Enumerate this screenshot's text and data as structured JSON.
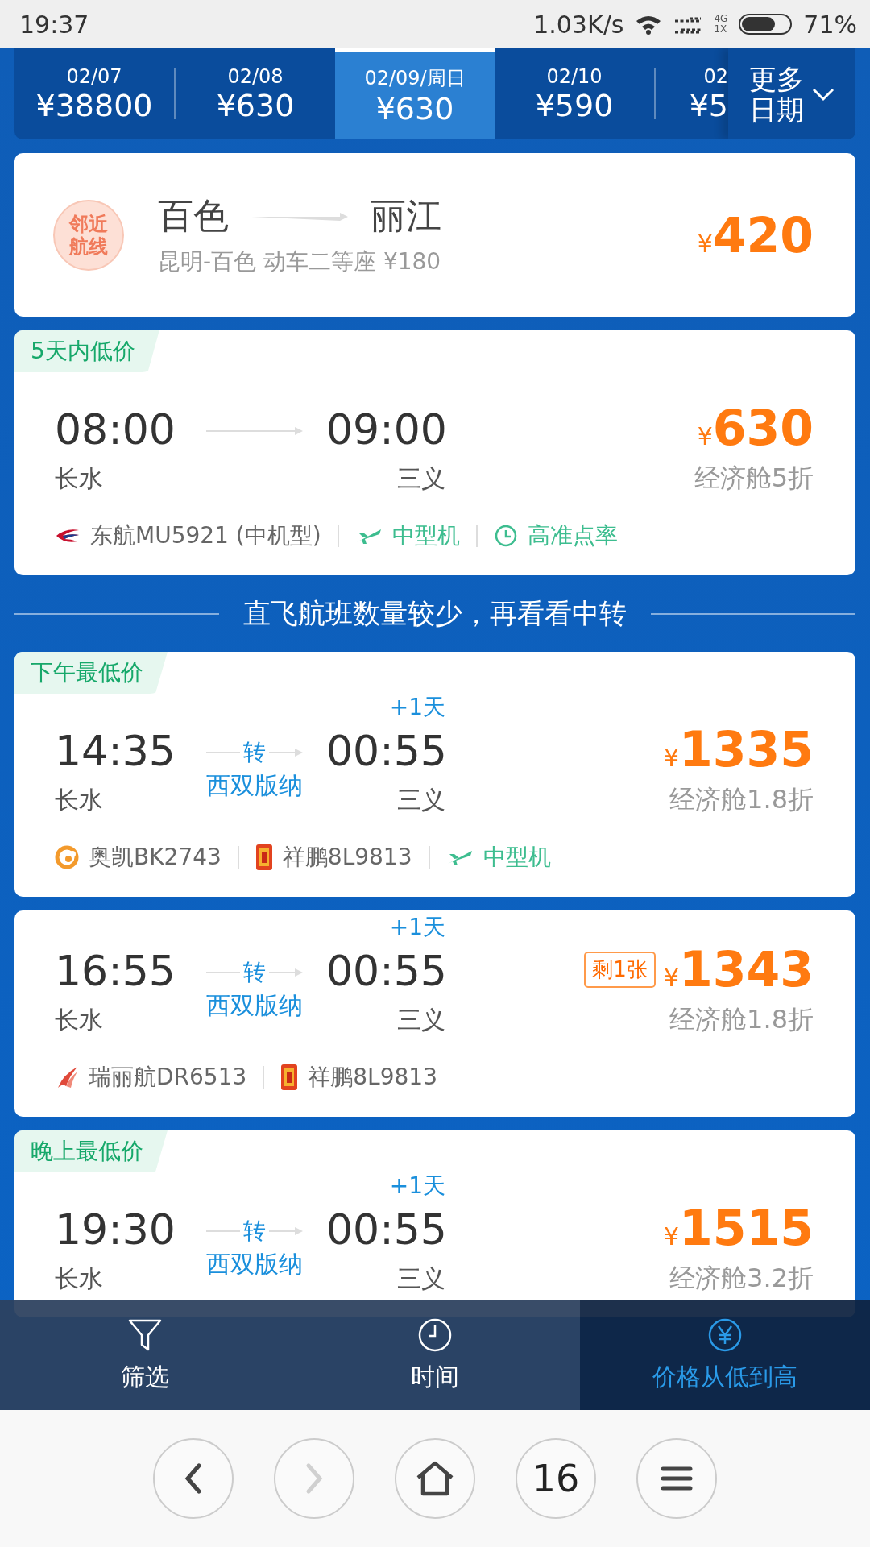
{
  "status_bar": {
    "time": "19:37",
    "speed": "1.03K/s",
    "network_top": "4G",
    "network_bottom": "1X",
    "battery": "71%"
  },
  "date_tabs": [
    {
      "date": "02/07",
      "price": "¥38800",
      "selected": false
    },
    {
      "date": "02/08",
      "price": "¥630",
      "selected": false
    },
    {
      "date": "02/09/周日",
      "price": "¥630",
      "selected": true
    },
    {
      "date": "02/10",
      "price": "¥590",
      "selected": false
    },
    {
      "date": "02",
      "price": "¥5",
      "selected": false
    }
  ],
  "more_dates": "更多日期",
  "nearby_route": {
    "badge": "邻近航线",
    "from": "百色",
    "to": "丽江",
    "detail": "昆明-百色 动车二等座 ¥180",
    "currency": "¥",
    "price": "420"
  },
  "flights": [
    {
      "tag": "5天内低价",
      "dep_time": "08:00",
      "arr_time": "09:00",
      "dep_airport": "长水",
      "arr_airport": "三义",
      "currency": "¥",
      "price": "630",
      "cabin": "经济舱5折",
      "segments": [
        {
          "kind": "swoosh",
          "text": "东航MU5921 (中机型)"
        },
        {
          "kind": "plane",
          "text": "中型机"
        },
        {
          "kind": "punctuality",
          "text": "高准点率"
        }
      ]
    },
    {
      "divider": "直飞航班数量较少，再看看中转"
    },
    {
      "tag": "下午最低价",
      "dep_time": "14:35",
      "arr_time": "00:55",
      "next_day": "+1天",
      "transfer": {
        "label": "转",
        "city": "西双版纳"
      },
      "dep_airport": "长水",
      "arr_airport": "三义",
      "currency": "¥",
      "price": "1335",
      "cabin": "经济舱1.8折",
      "segments": [
        {
          "kind": "ring",
          "text": "奥凯BK2743"
        },
        {
          "kind": "seal",
          "text": "祥鹏8L9813"
        },
        {
          "kind": "plane",
          "text": "中型机"
        }
      ]
    },
    {
      "dep_time": "16:55",
      "arr_time": "00:55",
      "next_day": "+1天",
      "transfer": {
        "label": "转",
        "city": "西双版纳"
      },
      "dep_airport": "长水",
      "arr_airport": "三义",
      "badge": "剩1张",
      "currency": "¥",
      "price": "1343",
      "cabin": "经济舱1.8折",
      "segments": [
        {
          "kind": "wing",
          "text": "瑞丽航DR6513"
        },
        {
          "kind": "seal",
          "text": "祥鹏8L9813"
        }
      ]
    },
    {
      "tag": "晚上最低价",
      "dep_time": "19:30",
      "arr_time": "00:55",
      "next_day": "+1天",
      "transfer": {
        "label": "转",
        "city": "西双版纳"
      },
      "dep_airport": "长水",
      "arr_airport": "三义",
      "currency": "¥",
      "price": "1515",
      "cabin": "经济舱3.2折"
    }
  ],
  "sort_bar": [
    {
      "label": "筛选",
      "selected": false
    },
    {
      "label": "时间",
      "selected": false
    },
    {
      "label": "价格从低到高",
      "selected": true
    }
  ],
  "browser_nav": [
    {
      "kind": "back",
      "disabled": false
    },
    {
      "kind": "forward",
      "disabled": true
    },
    {
      "kind": "home",
      "disabled": false
    },
    {
      "kind": "tabs",
      "count": "16",
      "disabled": false
    },
    {
      "kind": "menu",
      "disabled": false
    }
  ]
}
